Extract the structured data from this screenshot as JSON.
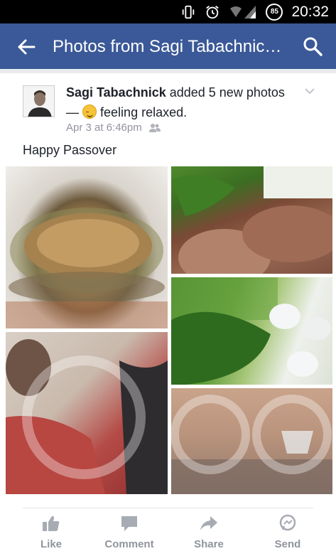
{
  "status_bar": {
    "time": "20:32",
    "battery_level": "85",
    "icons": [
      "vibrate-icon",
      "alarm-icon",
      "wifi-icon",
      "signal-icon",
      "battery-icon"
    ]
  },
  "app_bar": {
    "title": "Photos from Sagi Tabachnic…",
    "back_icon": "back-arrow-icon",
    "search_icon": "search-icon",
    "color": "#3b5998"
  },
  "post": {
    "author": "Sagi Tabachnick",
    "action_text": "added 5 new photos —",
    "feeling_text": "feeling relaxed.",
    "timestamp": "Apr 3 at 6:46pm",
    "text": "Happy Passover",
    "photos": [
      "photo-1",
      "photo-2",
      "photo-3",
      "photo-4",
      "photo-5"
    ]
  },
  "actions": [
    {
      "label": "Like",
      "icon": "thumbs-up-icon"
    },
    {
      "label": "Comment",
      "icon": "comment-icon"
    },
    {
      "label": "Share",
      "icon": "share-icon"
    },
    {
      "label": "Send",
      "icon": "messenger-icon"
    }
  ]
}
